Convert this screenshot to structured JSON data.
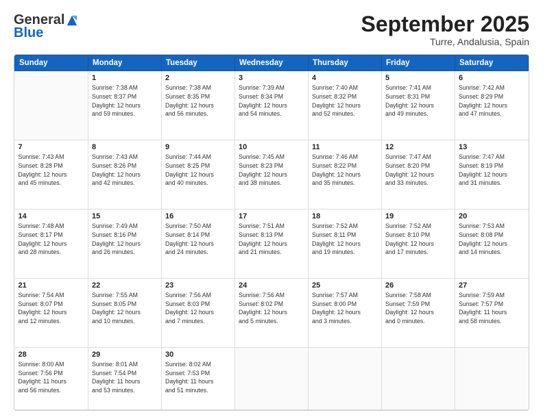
{
  "header": {
    "logo_general": "General",
    "logo_blue": "Blue",
    "month_title": "September 2025",
    "subtitle": "Turre, Andalusia, Spain"
  },
  "days_of_week": [
    "Sunday",
    "Monday",
    "Tuesday",
    "Wednesday",
    "Thursday",
    "Friday",
    "Saturday"
  ],
  "weeks": [
    [
      {
        "day": "",
        "info": ""
      },
      {
        "day": "1",
        "info": "Sunrise: 7:38 AM\nSunset: 8:37 PM\nDaylight: 12 hours\nand 59 minutes."
      },
      {
        "day": "2",
        "info": "Sunrise: 7:38 AM\nSunset: 8:35 PM\nDaylight: 12 hours\nand 56 minutes."
      },
      {
        "day": "3",
        "info": "Sunrise: 7:39 AM\nSunset: 8:34 PM\nDaylight: 12 hours\nand 54 minutes."
      },
      {
        "day": "4",
        "info": "Sunrise: 7:40 AM\nSunset: 8:32 PM\nDaylight: 12 hours\nand 52 minutes."
      },
      {
        "day": "5",
        "info": "Sunrise: 7:41 AM\nSunset: 8:31 PM\nDaylight: 12 hours\nand 49 minutes."
      },
      {
        "day": "6",
        "info": "Sunrise: 7:42 AM\nSunset: 8:29 PM\nDaylight: 12 hours\nand 47 minutes."
      }
    ],
    [
      {
        "day": "7",
        "info": "Sunrise: 7:43 AM\nSunset: 8:28 PM\nDaylight: 12 hours\nand 45 minutes."
      },
      {
        "day": "8",
        "info": "Sunrise: 7:43 AM\nSunset: 8:26 PM\nDaylight: 12 hours\nand 42 minutes."
      },
      {
        "day": "9",
        "info": "Sunrise: 7:44 AM\nSunset: 8:25 PM\nDaylight: 12 hours\nand 40 minutes."
      },
      {
        "day": "10",
        "info": "Sunrise: 7:45 AM\nSunset: 8:23 PM\nDaylight: 12 hours\nand 38 minutes."
      },
      {
        "day": "11",
        "info": "Sunrise: 7:46 AM\nSunset: 8:22 PM\nDaylight: 12 hours\nand 35 minutes."
      },
      {
        "day": "12",
        "info": "Sunrise: 7:47 AM\nSunset: 8:20 PM\nDaylight: 12 hours\nand 33 minutes."
      },
      {
        "day": "13",
        "info": "Sunrise: 7:47 AM\nSunset: 8:19 PM\nDaylight: 12 hours\nand 31 minutes."
      }
    ],
    [
      {
        "day": "14",
        "info": "Sunrise: 7:48 AM\nSunset: 8:17 PM\nDaylight: 12 hours\nand 28 minutes."
      },
      {
        "day": "15",
        "info": "Sunrise: 7:49 AM\nSunset: 8:16 PM\nDaylight: 12 hours\nand 26 minutes."
      },
      {
        "day": "16",
        "info": "Sunrise: 7:50 AM\nSunset: 8:14 PM\nDaylight: 12 hours\nand 24 minutes."
      },
      {
        "day": "17",
        "info": "Sunrise: 7:51 AM\nSunset: 8:13 PM\nDaylight: 12 hours\nand 21 minutes."
      },
      {
        "day": "18",
        "info": "Sunrise: 7:52 AM\nSunset: 8:11 PM\nDaylight: 12 hours\nand 19 minutes."
      },
      {
        "day": "19",
        "info": "Sunrise: 7:52 AM\nSunset: 8:10 PM\nDaylight: 12 hours\nand 17 minutes."
      },
      {
        "day": "20",
        "info": "Sunrise: 7:53 AM\nSunset: 8:08 PM\nDaylight: 12 hours\nand 14 minutes."
      }
    ],
    [
      {
        "day": "21",
        "info": "Sunrise: 7:54 AM\nSunset: 8:07 PM\nDaylight: 12 hours\nand 12 minutes."
      },
      {
        "day": "22",
        "info": "Sunrise: 7:55 AM\nSunset: 8:05 PM\nDaylight: 12 hours\nand 10 minutes."
      },
      {
        "day": "23",
        "info": "Sunrise: 7:56 AM\nSunset: 8:03 PM\nDaylight: 12 hours\nand 7 minutes."
      },
      {
        "day": "24",
        "info": "Sunrise: 7:56 AM\nSunset: 8:02 PM\nDaylight: 12 hours\nand 5 minutes."
      },
      {
        "day": "25",
        "info": "Sunrise: 7:57 AM\nSunset: 8:00 PM\nDaylight: 12 hours\nand 3 minutes."
      },
      {
        "day": "26",
        "info": "Sunrise: 7:58 AM\nSunset: 7:59 PM\nDaylight: 12 hours\nand 0 minutes."
      },
      {
        "day": "27",
        "info": "Sunrise: 7:59 AM\nSunset: 7:57 PM\nDaylight: 11 hours\nand 58 minutes."
      }
    ],
    [
      {
        "day": "28",
        "info": "Sunrise: 8:00 AM\nSunset: 7:56 PM\nDaylight: 11 hours\nand 56 minutes."
      },
      {
        "day": "29",
        "info": "Sunrise: 8:01 AM\nSunset: 7:54 PM\nDaylight: 11 hours\nand 53 minutes."
      },
      {
        "day": "30",
        "info": "Sunrise: 8:02 AM\nSunset: 7:53 PM\nDaylight: 11 hours\nand 51 minutes."
      },
      {
        "day": "",
        "info": ""
      },
      {
        "day": "",
        "info": ""
      },
      {
        "day": "",
        "info": ""
      },
      {
        "day": "",
        "info": ""
      }
    ]
  ]
}
